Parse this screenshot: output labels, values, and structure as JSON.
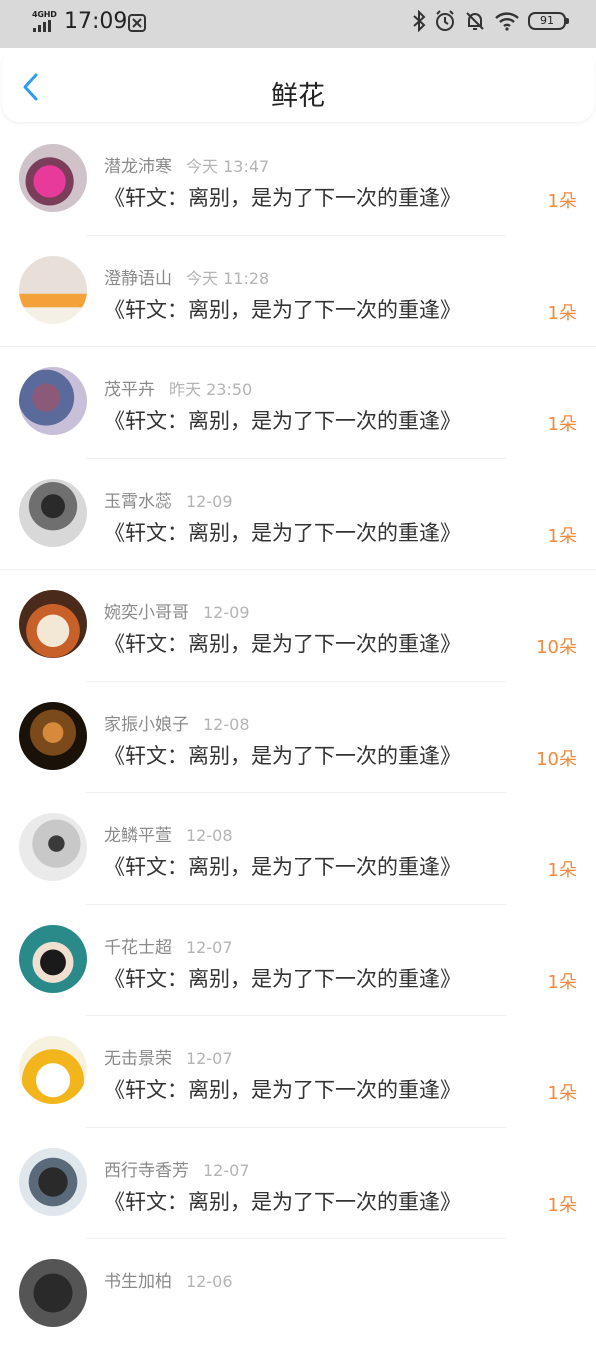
{
  "status_bar": {
    "network": "4GHD",
    "time": "17:09",
    "battery": "91"
  },
  "header": {
    "title": "鲜花"
  },
  "colors": {
    "accent_blue": "#2e9bf0",
    "count_orange": "#f08a3c"
  },
  "items": [
    {
      "name": "潜龙沛寒",
      "time": "今天 13:47",
      "message": "《轩文：离别，是为了下一次的重逢》",
      "count": "1朵"
    },
    {
      "name": "澄静语山",
      "time": "今天 11:28",
      "message": "《轩文：离别，是为了下一次的重逢》",
      "count": "1朵"
    },
    {
      "name": "茂平卉",
      "time": "昨天 23:50",
      "message": "《轩文：离别，是为了下一次的重逢》",
      "count": "1朵"
    },
    {
      "name": "玉霄水蕊",
      "time": "12-09",
      "message": "《轩文：离别，是为了下一次的重逢》",
      "count": "1朵"
    },
    {
      "name": "婉奕小哥哥",
      "time": "12-09",
      "message": "《轩文：离别，是为了下一次的重逢》",
      "count": "10朵"
    },
    {
      "name": "家振小娘子",
      "time": "12-08",
      "message": "《轩文：离别，是为了下一次的重逢》",
      "count": "10朵"
    },
    {
      "name": "龙鳞平萱",
      "time": "12-08",
      "message": "《轩文：离别，是为了下一次的重逢》",
      "count": "1朵"
    },
    {
      "name": "千花士超",
      "time": "12-07",
      "message": "《轩文：离别，是为了下一次的重逢》",
      "count": "1朵"
    },
    {
      "name": "无击景荣",
      "time": "12-07",
      "message": "《轩文：离别，是为了下一次的重逢》",
      "count": "1朵"
    },
    {
      "name": "西行寺香芳",
      "time": "12-07",
      "message": "《轩文：离别，是为了下一次的重逢》",
      "count": "1朵"
    },
    {
      "name": "书生加柏",
      "time": "12-06",
      "message": "",
      "count": ""
    }
  ]
}
